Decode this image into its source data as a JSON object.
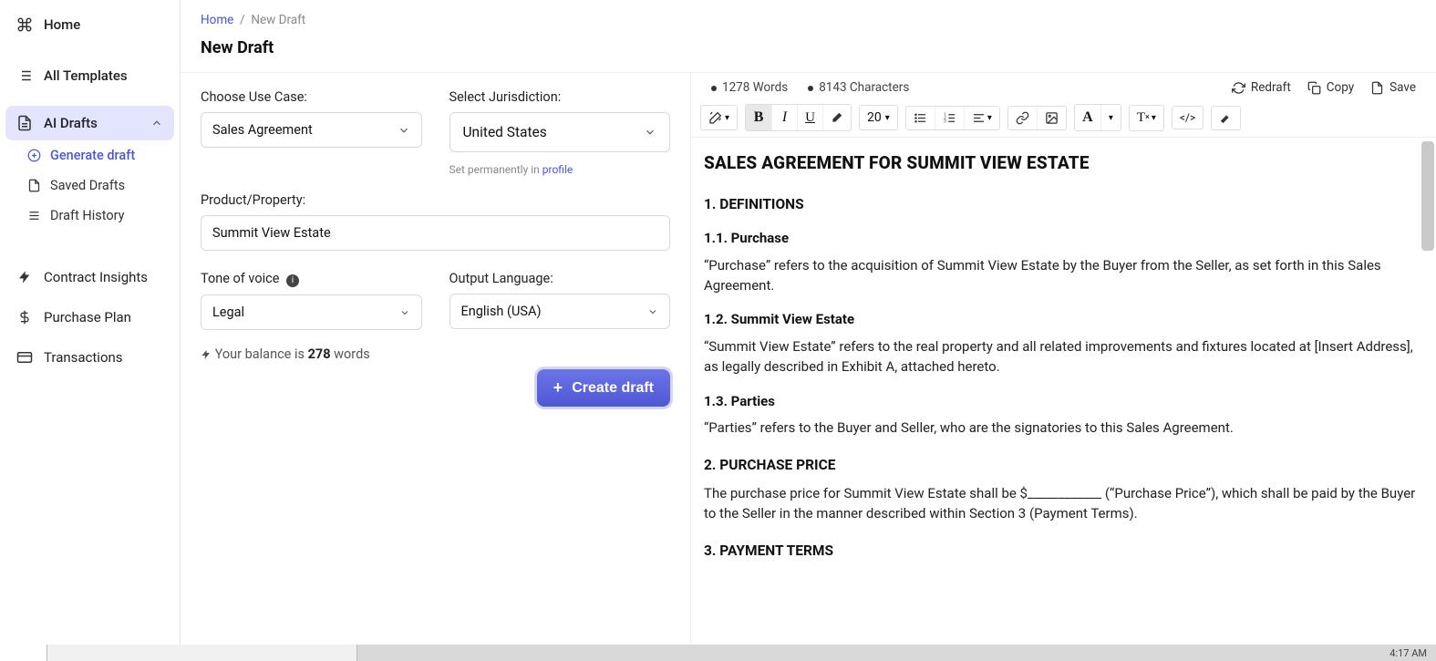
{
  "sidebar": {
    "home": "Home",
    "all_templates": "All Templates",
    "ai_drafts": "AI Drafts",
    "subs": {
      "generate": "Generate draft",
      "saved": "Saved Drafts",
      "history": "Draft History"
    },
    "insights": "Contract Insights",
    "purchase": "Purchase Plan",
    "transactions": "Transactions"
  },
  "breadcrumb": {
    "home": "Home",
    "current": "New Draft"
  },
  "page_title": "New Draft",
  "form": {
    "use_case_label": "Choose Use Case:",
    "use_case_value": "Sales Agreement",
    "jurisdiction_label": "Select Jurisdiction:",
    "jurisdiction_value": "United States",
    "jurisdiction_hint_pre": "Set permanently in ",
    "jurisdiction_hint_link": "profile",
    "product_label": "Product/Property:",
    "product_value": "Summit View Estate",
    "tone_label": "Tone of voice ",
    "tone_value": "Legal",
    "lang_label": "Output Language:",
    "lang_value": "English (USA)",
    "balance_pre": "Your balance is ",
    "balance_val": "278",
    "balance_post": " words",
    "create_btn": "Create draft"
  },
  "preview": {
    "words": "1278 Words",
    "chars": "8143 Characters",
    "redraft": "Redraft",
    "copy": "Copy",
    "save": "Save",
    "fontsize": "20"
  },
  "doc": {
    "title": "SALES AGREEMENT FOR SUMMIT VIEW ESTATE",
    "s1": "1. DEFINITIONS",
    "s11": "1.1. Purchase",
    "p11": "“Purchase” refers to the acquisition of Summit View Estate by the Buyer from the Seller, as set forth in this Sales Agreement.",
    "s12": "1.2. Summit View Estate",
    "p12": "“Summit View Estate” refers to the real property and all related improvements and fixtures located at [Insert Address], as legally described in Exhibit A, attached hereto.",
    "s13": "1.3. Parties",
    "p13": "“Parties” refers to the Buyer and Seller, who are the signatories to this Sales Agreement.",
    "s2": "2. PURCHASE PRICE",
    "p2": "The purchase price for Summit View Estate shall be $____________ (“Purchase Price”), which shall be paid by the Buyer to the Seller in the manner described within Section 3 (Payment Terms).",
    "s3": "3. PAYMENT TERMS"
  },
  "taskbar": {
    "time": "4:17 AM"
  }
}
